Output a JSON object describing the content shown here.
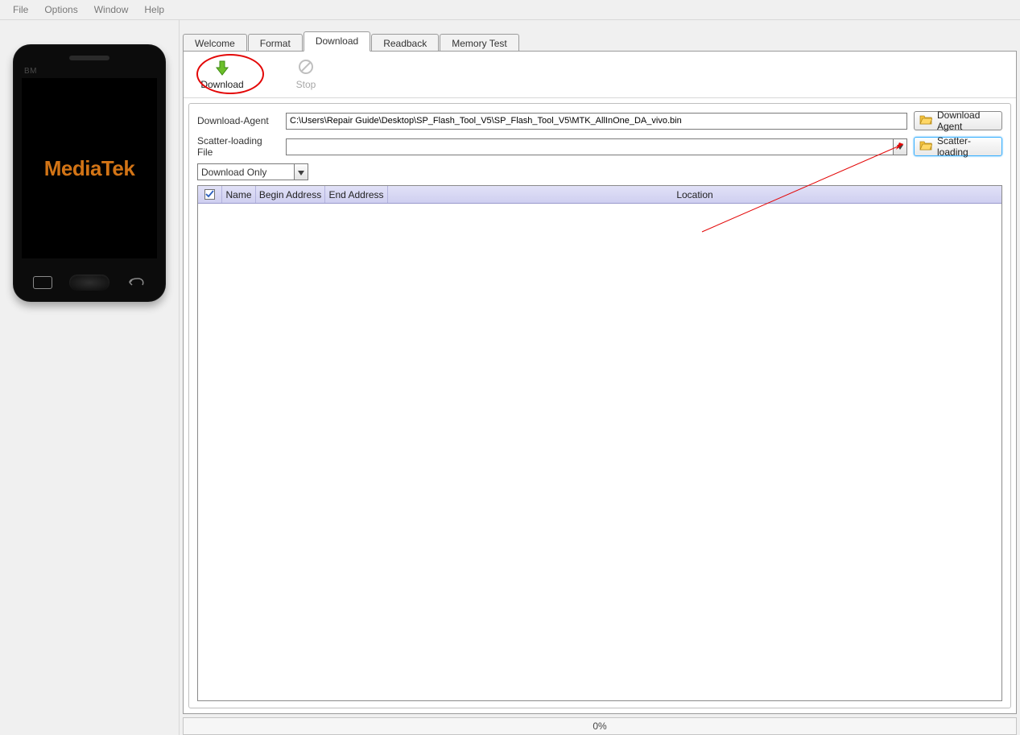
{
  "menu": {
    "file": "File",
    "options": "Options",
    "window": "Window",
    "help": "Help"
  },
  "phone": {
    "bm": "BM",
    "brand": "MediaTek"
  },
  "tabs": {
    "welcome": "Welcome",
    "format": "Format",
    "download": "Download",
    "readback": "Readback",
    "memory_test": "Memory Test",
    "active": "download"
  },
  "toolbar": {
    "download_label": "Download",
    "stop_label": "Stop"
  },
  "form": {
    "download_agent_label": "Download-Agent",
    "download_agent_value": "C:\\Users\\Repair Guide\\Desktop\\SP_Flash_Tool_V5\\SP_Flash_Tool_V5\\MTK_AllInOne_DA_vivo.bin",
    "download_agent_btn": "Download Agent",
    "scatter_label": "Scatter-loading File",
    "scatter_value": "",
    "scatter_btn": "Scatter-loading",
    "mode_selected": "Download Only"
  },
  "table": {
    "headers": {
      "name": "Name",
      "begin": "Begin Address",
      "end": "End Address",
      "location": "Location"
    },
    "rows": []
  },
  "status": {
    "progress_text": "0%"
  }
}
